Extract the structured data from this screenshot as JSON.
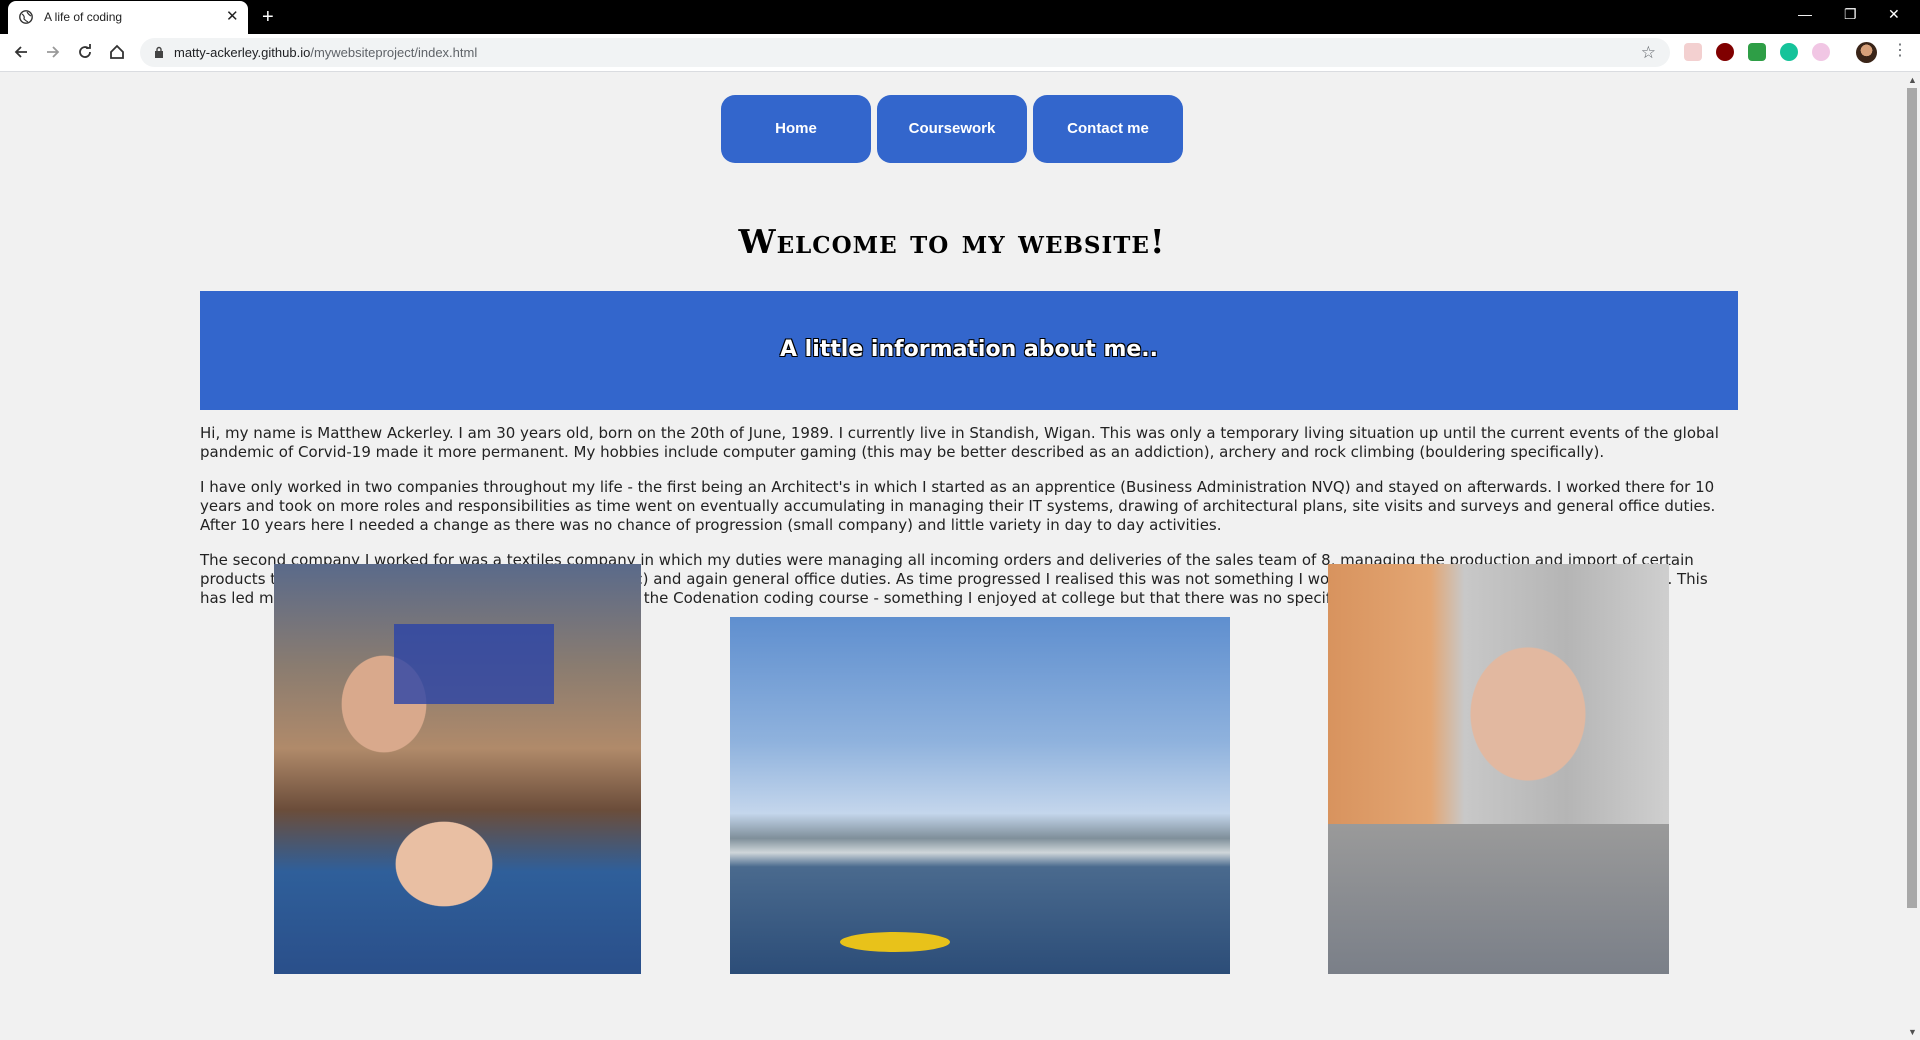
{
  "browser": {
    "tab_title": "A life of coding",
    "tab_close": "✕",
    "new_tab": "+",
    "url_host": "matty-ackerley.github.io",
    "url_path": "/mywebsiteproject/index.html",
    "bookmark_star": "☆",
    "window_controls": {
      "minimize": "—",
      "restore": "❐",
      "close": "✕"
    },
    "extensions": [
      {
        "name": "extension-1",
        "color": "#e8a0a0"
      },
      {
        "name": "extension-ublock",
        "color": "#800000"
      },
      {
        "name": "extension-green",
        "color": "#2e9e46"
      },
      {
        "name": "extension-grammarly",
        "color": "#15c39a"
      },
      {
        "name": "extension-pink",
        "color": "#e7b2d8"
      }
    ],
    "menu": "⋮"
  },
  "nav": {
    "home": "Home",
    "coursework": "Coursework",
    "contact": "Contact me"
  },
  "page": {
    "title": "Welcome to my website!",
    "banner": "A little information about me..",
    "paragraphs": [
      "Hi, my name is Matthew Ackerley. I am 30 years old, born on the 20th of June, 1989. I currently live in Standish, Wigan. This was only a temporary living situation up until the current events of the global pandemic of Corvid-19 made it more permanent. My hobbies include computer gaming (this may be better described as an addiction), archery and rock climbing (bouldering specifically).",
      "I have only worked in two companies throughout my life - the first being an Architect's in which I started as an apprentice (Business Administration NVQ) and stayed on afterwards. I worked there for 10 years and took on more roles and responsibilities as time went on eventually accumulating in managing their IT systems, drawing of architectural plans, site visits and surveys and general office duties. After 10 years here I needed a change as there was no chance of progression (small company) and little variety in day to day activities.",
      "The second company I worked for was a textiles company in which my duties were managing all incoming orders and deliveries of the sales team of 8, managing the production and import of certain products the company sold (fabric books, mini-curtains etc) and again general office duties. As time progressed I realised this was not something I would want to do for a prolonged period of time. This has led me to look at re-training and how I have arrived at the Codenation coding course - something I enjoyed at college but that there was no specific course for."
    ]
  },
  "colors": {
    "accent": "#3366cc",
    "background": "#f1f1f1"
  }
}
